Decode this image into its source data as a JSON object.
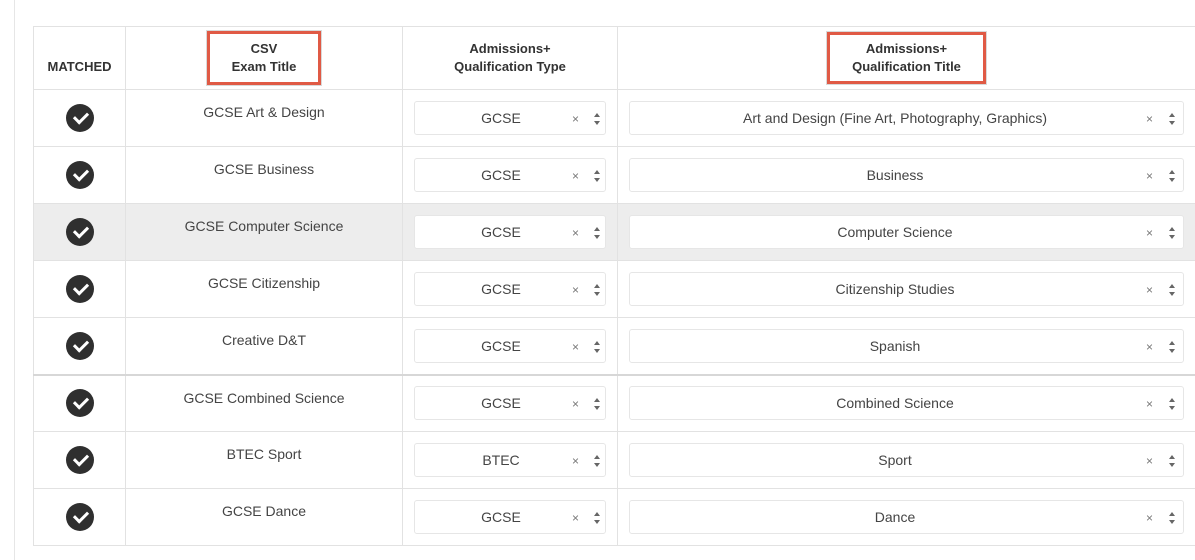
{
  "headers": {
    "matched": "MATCHED",
    "csv_line1": "CSV",
    "csv_line2": "Exam Title",
    "type_line1": "Admissions+",
    "type_line2": "Qualification Type",
    "title_line1": "Admissions+",
    "title_line2": "Qualification Title"
  },
  "rows": [
    {
      "matched": true,
      "exam": "GCSE Art & Design",
      "type": "GCSE",
      "title": "Art and Design (Fine Art, Photography, Graphics)"
    },
    {
      "matched": true,
      "exam": "GCSE Business",
      "type": "GCSE",
      "title": "Business"
    },
    {
      "matched": true,
      "exam": "GCSE Computer Science",
      "type": "GCSE",
      "title": "Computer Science"
    },
    {
      "matched": true,
      "exam": "GCSE Citizenship",
      "type": "GCSE",
      "title": "Citizenship Studies"
    },
    {
      "matched": true,
      "exam": "Creative D&T",
      "type": "GCSE",
      "title": "Spanish"
    },
    {
      "matched": true,
      "exam": "GCSE Combined Science",
      "type": "GCSE",
      "title": "Combined Science"
    },
    {
      "matched": true,
      "exam": "BTEC Sport",
      "type": "BTEC",
      "title": "Sport"
    },
    {
      "matched": true,
      "exam": "GCSE Dance",
      "type": "GCSE",
      "title": "Dance"
    }
  ],
  "clear_symbol": "×",
  "colors": {
    "highlight_box": "#e05a45",
    "check_circle": "#2f2f2f",
    "row_hover": "#ededed"
  },
  "icons": {
    "matched": "check-circle-icon",
    "clear": "close-icon",
    "dropdown": "sort-arrows-icon"
  }
}
